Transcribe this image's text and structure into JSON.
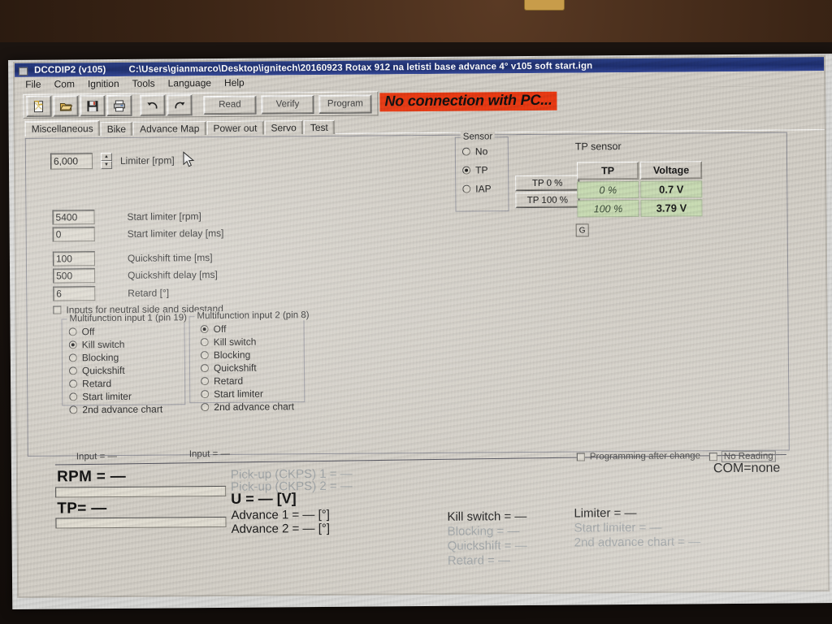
{
  "window": {
    "app_title": "DCCDIP2 (v105)",
    "file_path": "C:\\Users\\gianmarco\\Desktop\\ignitech\\20160923 Rotax 912 na letisti base advance 4° v105 soft start.ign",
    "title_icon": "app-document-icon"
  },
  "menu": [
    "File",
    "Com",
    "Ignition",
    "Tools",
    "Language",
    "Help"
  ],
  "toolbar": {
    "icons": [
      "new-file-icon",
      "open-folder-icon",
      "save-floppy-icon",
      "print-icon",
      "undo-icon",
      "redo-icon"
    ],
    "read_label": "Read",
    "verify_label": "Verify",
    "program_label": "Program"
  },
  "status_banner": {
    "text": "No connection with PC...",
    "bg_color": "#ea3a13",
    "text_color": "#111111"
  },
  "tabs": [
    {
      "label": "Miscellaneous",
      "selected": true
    },
    {
      "label": "Bike",
      "selected": false
    },
    {
      "label": "Advance Map",
      "selected": false
    },
    {
      "label": "Power out",
      "selected": false
    },
    {
      "label": "Servo",
      "selected": false
    },
    {
      "label": "Test",
      "selected": false
    }
  ],
  "misc": {
    "limiter": {
      "value": "6,000",
      "label": "Limiter [rpm]"
    },
    "fields": [
      {
        "value": "5400",
        "label": "Start limiter [rpm]"
      },
      {
        "value": "0",
        "label": "Start limiter delay [ms]"
      },
      {
        "value": "100",
        "label": "Quickshift time [ms]"
      },
      {
        "value": "500",
        "label": "Quickshift delay [ms]"
      },
      {
        "value": "6",
        "label": "Retard [°]"
      }
    ],
    "neutral_checkbox": {
      "label": "Inputs for neutral side and sidestand",
      "checked": false
    },
    "multifunction_1": {
      "caption": "Multifunction input 1 (pin 19)",
      "options": [
        "Off",
        "Kill switch",
        "Blocking",
        "Quickshift",
        "Retard",
        "Start limiter",
        "2nd advance chart"
      ],
      "selected": "Kill switch"
    },
    "multifunction_2": {
      "caption": "Multifunction input 2 (pin 8)",
      "options": [
        "Off",
        "Kill switch",
        "Blocking",
        "Quickshift",
        "Retard",
        "Start limiter",
        "2nd advance chart"
      ],
      "selected": "Off"
    }
  },
  "sensor_group": {
    "caption": "Sensor",
    "options": [
      "No",
      "TP",
      "IAP"
    ],
    "selected": "TP"
  },
  "tp_sensor": {
    "title": "TP sensor",
    "btn_0": "TP 0 %",
    "btn_100": "TP 100 %",
    "g_label": "G",
    "headers": [
      "TP",
      "Voltage"
    ],
    "rows": [
      {
        "tp": "0 %",
        "voltage": "0.7 V"
      },
      {
        "tp": "100 %",
        "voltage": "3.79 V"
      }
    ],
    "cell_bg": "#c9dcb4"
  },
  "readouts": {
    "input_left": "Input = —",
    "input_right": "Input = —",
    "rpm": "RPM = —",
    "tp": "TP= —",
    "pickup1": "Pick-up (CKPS) 1 = —",
    "pickup2": "Pick-up (CKPS) 2 = —",
    "voltage": "U = — [V]",
    "advance1": "Advance 1 = — [°]",
    "advance2": "Advance 2 = — [°]",
    "kill_switch": "Kill switch = —",
    "blocking": "Blocking = —",
    "quickshift": "Quickshift = —",
    "retard": "Retard = —",
    "limiter": "Limiter = —",
    "start_limiter": "Start limiter = —",
    "second_advance_chart": "2nd advance chart = —"
  },
  "footer": {
    "programming_after_change": {
      "label": "Programming after change",
      "checked": false
    },
    "no_reading": {
      "label": "No Reading",
      "checked": false
    },
    "com": "COM=none"
  }
}
